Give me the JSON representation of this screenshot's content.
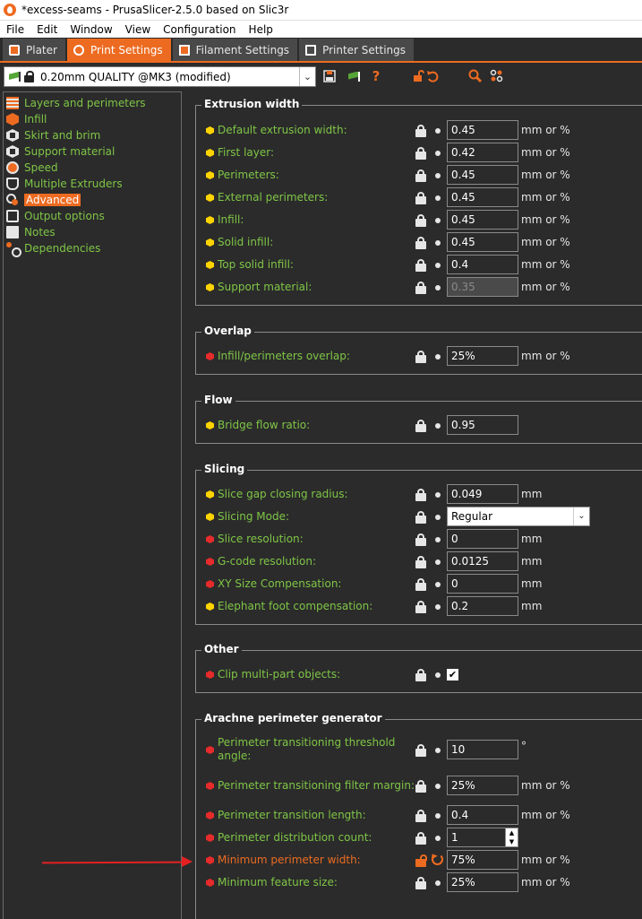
{
  "window": {
    "title": "*excess-seams - PrusaSlicer-2.5.0 based on Slic3r"
  },
  "menu": [
    "File",
    "Edit",
    "Window",
    "View",
    "Configuration",
    "Help"
  ],
  "tabs": [
    {
      "label": "Plater",
      "icon": "plater-icon",
      "active": false
    },
    {
      "label": "Print Settings",
      "icon": "gear-icon",
      "active": true
    },
    {
      "label": "Filament Settings",
      "icon": "filament-icon",
      "active": false
    },
    {
      "label": "Printer Settings",
      "icon": "printer-icon",
      "active": false
    }
  ],
  "preset": {
    "name": "0.20mm QUALITY @MK3 (modified)"
  },
  "toolbar": {
    "question": "?"
  },
  "tree": [
    {
      "label": "Layers and perimeters",
      "icon": "layers-icon"
    },
    {
      "label": "Infill",
      "icon": "infill-icon"
    },
    {
      "label": "Skirt and brim",
      "icon": "skirt-icon"
    },
    {
      "label": "Support material",
      "icon": "support-icon"
    },
    {
      "label": "Speed",
      "icon": "speed-icon"
    },
    {
      "label": "Multiple Extruders",
      "icon": "extruder-icon"
    },
    {
      "label": "Advanced",
      "icon": "advanced-icon",
      "selected": true
    },
    {
      "label": "Output options",
      "icon": "output-icon"
    },
    {
      "label": "Notes",
      "icon": "notes-icon"
    },
    {
      "label": "Dependencies",
      "icon": "dependencies-icon"
    }
  ],
  "groups": {
    "extrusion": {
      "title": "Extrusion width",
      "rows": [
        {
          "label": "Default extrusion width:",
          "value": "0.45",
          "unit": "mm or %"
        },
        {
          "label": "First layer:",
          "value": "0.42",
          "unit": "mm or %"
        },
        {
          "label": "Perimeters:",
          "value": "0.45",
          "unit": "mm or %"
        },
        {
          "label": "External perimeters:",
          "value": "0.45",
          "unit": "mm or %"
        },
        {
          "label": "Infill:",
          "value": "0.45",
          "unit": "mm or %"
        },
        {
          "label": "Solid infill:",
          "value": "0.45",
          "unit": "mm or %"
        },
        {
          "label": "Top solid infill:",
          "value": "0.4",
          "unit": "mm or %"
        },
        {
          "label": "Support material:",
          "value": "0.35",
          "unit": "mm or %"
        }
      ]
    },
    "overlap": {
      "title": "Overlap",
      "rows": [
        {
          "label": "Infill/perimeters overlap:",
          "value": "25%",
          "unit": "mm or %"
        }
      ]
    },
    "flow": {
      "title": "Flow",
      "rows": [
        {
          "label": "Bridge flow ratio:",
          "value": "0.95",
          "unit": ""
        }
      ]
    },
    "slicing": {
      "title": "Slicing",
      "rows": [
        {
          "label": "Slice gap closing radius:",
          "value": "0.049",
          "unit": "mm"
        },
        {
          "label": "Slicing Mode:",
          "value": "Regular",
          "unit": ""
        },
        {
          "label": "Slice resolution:",
          "value": "0",
          "unit": "mm"
        },
        {
          "label": "G-code resolution:",
          "value": "0.0125",
          "unit": "mm"
        },
        {
          "label": "XY Size Compensation:",
          "value": "0",
          "unit": "mm"
        },
        {
          "label": "Elephant foot compensation:",
          "value": "0.2",
          "unit": "mm"
        }
      ]
    },
    "other": {
      "title": "Other",
      "rows": [
        {
          "label": "Clip multi-part objects:",
          "value": "✔",
          "unit": ""
        }
      ]
    },
    "arachne": {
      "title": "Arachne perimeter generator",
      "rows": [
        {
          "label": "Perimeter transitioning threshold angle:",
          "value": "10",
          "unit": "°"
        },
        {
          "label": "Perimeter transitioning filter margin:",
          "value": "25%",
          "unit": "mm or %"
        },
        {
          "label": "Perimeter transition length:",
          "value": "0.4",
          "unit": "mm or %"
        },
        {
          "label": "Perimeter distribution count:",
          "value": "1",
          "unit": ""
        },
        {
          "label": "Minimum perimeter width:",
          "value": "75%",
          "unit": "mm or %"
        },
        {
          "label": "Minimum feature size:",
          "value": "25%",
          "unit": "mm or %"
        }
      ]
    }
  },
  "colors": {
    "accent": "#ed6b21",
    "label_green": "#7fc646",
    "simple_bullet": "#ffd400",
    "expert_bullet": "#e52b2b",
    "annotation_arrow": "#e52020"
  }
}
